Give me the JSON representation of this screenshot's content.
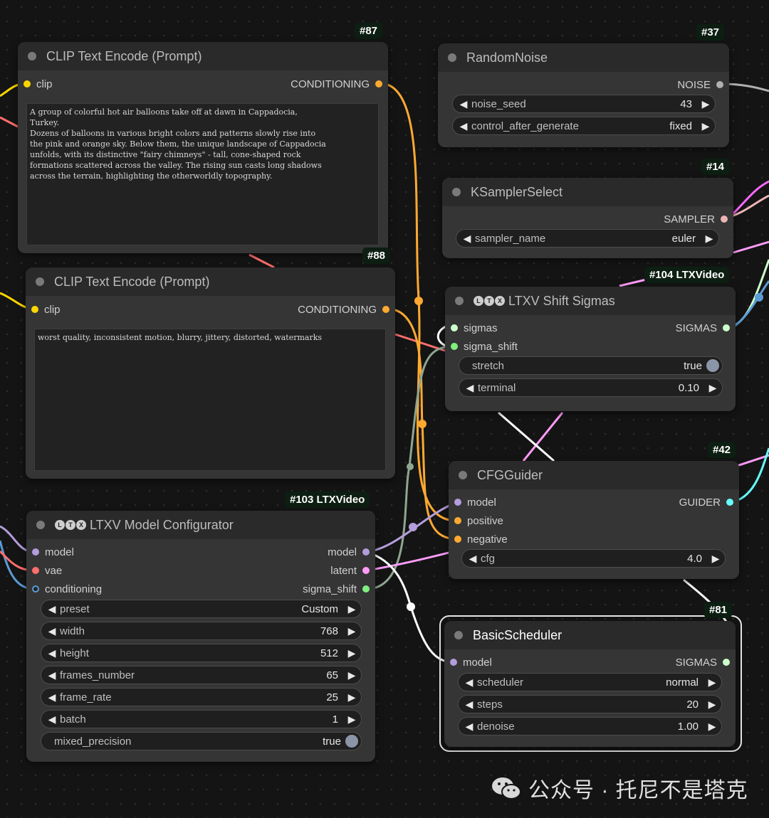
{
  "nodes": {
    "clip_encode_pos": {
      "badge": "#87",
      "title": "CLIP Text Encode (Prompt)",
      "input_label": "clip",
      "output_label": "CONDITIONING",
      "text": "A group of colorful hot air balloons take off at dawn in Cappadocia,\nTurkey.\nDozens of balloons in various bright colors and patterns slowly rise into\nthe pink and orange sky. Below them, the unique landscape of Cappadocia\nunfolds, with its distinctive \"fairy chimneys\" - tall, cone-shaped rock\nformations scattered across the valley. The rising sun casts long shadows\nacross the terrain, highlighting the otherworldly topography."
    },
    "clip_encode_neg": {
      "badge": "#88",
      "title": "CLIP Text Encode (Prompt)",
      "input_label": "clip",
      "output_label": "CONDITIONING",
      "text": "worst quality, inconsistent motion, blurry, jittery, distorted, watermarks"
    },
    "random_noise": {
      "badge": "#37",
      "title": "RandomNoise",
      "output_label": "NOISE",
      "widgets": [
        {
          "label": "noise_seed",
          "value": "43"
        },
        {
          "label": "control_after_generate",
          "value": "fixed"
        }
      ]
    },
    "ksampler_select": {
      "badge": "#14",
      "title": "KSamplerSelect",
      "output_label": "SAMPLER",
      "widgets": [
        {
          "label": "sampler_name",
          "value": "euler"
        }
      ]
    },
    "shift_sigmas": {
      "badge": "#104 LTXVideo",
      "title": "LTXV Shift Sigmas",
      "inputs": [
        "sigmas",
        "sigma_shift"
      ],
      "output_label": "SIGMAS",
      "widgets": [
        {
          "label": "stretch",
          "value": "true"
        },
        {
          "label": "terminal",
          "value": "0.10"
        }
      ]
    },
    "cfg_guider": {
      "badge": "#42",
      "title": "CFGGuider",
      "inputs": [
        "model",
        "positive",
        "negative"
      ],
      "output_label": "GUIDER",
      "widgets": [
        {
          "label": "cfg",
          "value": "4.0"
        }
      ]
    },
    "model_config": {
      "badge": "#103 LTXVideo",
      "title": "LTXV Model Configurator",
      "inputs": [
        "model",
        "vae",
        "conditioning"
      ],
      "outputs": [
        "model",
        "latent",
        "sigma_shift"
      ],
      "widgets": [
        {
          "label": "preset",
          "value": "Custom"
        },
        {
          "label": "width",
          "value": "768"
        },
        {
          "label": "height",
          "value": "512"
        },
        {
          "label": "frames_number",
          "value": "65"
        },
        {
          "label": "frame_rate",
          "value": "25"
        },
        {
          "label": "batch",
          "value": "1"
        },
        {
          "label": "mixed_precision",
          "value": "true"
        }
      ]
    },
    "basic_scheduler": {
      "badge": "#81",
      "title": "BasicScheduler",
      "input_label": "model",
      "output_label": "SIGMAS",
      "widgets": [
        {
          "label": "scheduler",
          "value": "normal"
        },
        {
          "label": "steps",
          "value": "20"
        },
        {
          "label": "denoise",
          "value": "1.00"
        }
      ]
    }
  },
  "ltx_logo": [
    "L",
    "T",
    "X"
  ],
  "watermark": {
    "text": "公众号 · 托尼不是塔克",
    "icon": "wechat-icon"
  },
  "colors": {
    "clip": "#ffd500",
    "conditioning": "#ffa931",
    "model": "#b39ddb",
    "vae": "#ff6e6e",
    "latent": "#ff9cf9",
    "sigmas": "#cdffcd",
    "sampler": "#ecb4b4",
    "guider": "#66ffff",
    "noise": "#b0b0b0",
    "float": "#7aa7e6",
    "sigma_shift": "#7ff07f"
  }
}
